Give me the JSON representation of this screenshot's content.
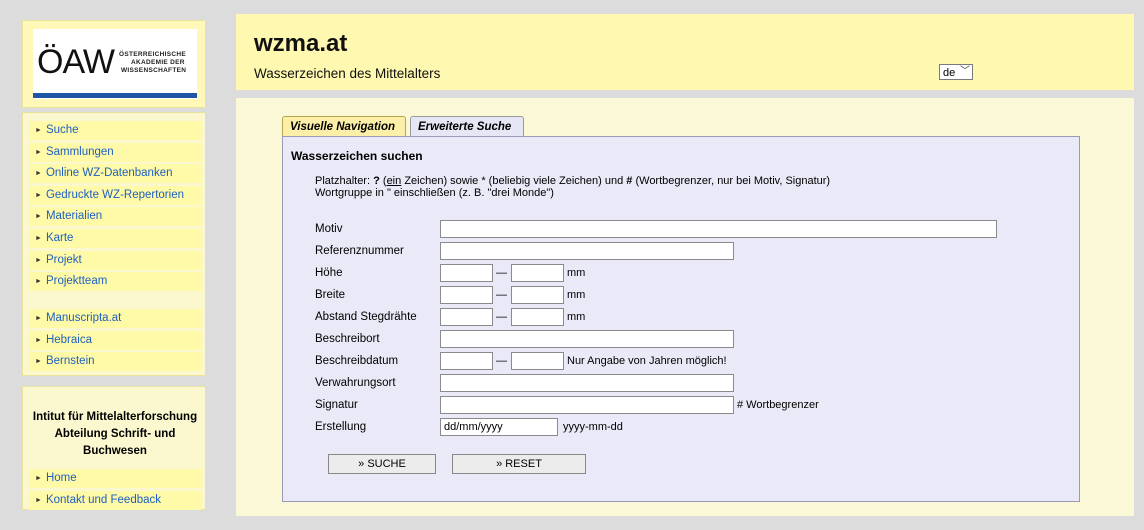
{
  "logo": {
    "big_text": "ÖAW",
    "small_line1": "ÖSTERREICHISCHE",
    "small_line2": "AKADEMIE DER",
    "small_line3": "WISSENSCHAFTEN",
    "bar_color": "#1f56a6"
  },
  "sidebar": {
    "items": [
      {
        "label": "Suche"
      },
      {
        "label": "Sammlungen"
      },
      {
        "label": "Online WZ-Datenbanken"
      },
      {
        "label": "Gedruckte WZ-Repertorien"
      },
      {
        "label": "Materialien"
      },
      {
        "label": "Karte"
      },
      {
        "label": "Projekt"
      },
      {
        "label": "Projektteam"
      }
    ],
    "items2": [
      {
        "label": "Manuscripta.at"
      },
      {
        "label": "Hebraica"
      },
      {
        "label": "Bernstein"
      }
    ],
    "arrow_glyph": "►"
  },
  "info": {
    "line1": "Intitut für Mittelalterforschung",
    "line2": "Abteilung Schrift- und",
    "line3": "Buchwesen",
    "links": [
      {
        "label": "Home"
      },
      {
        "label": "Kontakt und Feedback"
      }
    ]
  },
  "header": {
    "title": "wzma.at",
    "subtitle": "Wasserzeichen des Mittelalters",
    "language": "de"
  },
  "tabs": [
    {
      "label": "Visuelle Navigation"
    },
    {
      "label": "Erweiterte Suche"
    }
  ],
  "form": {
    "title": "Wasserzeichen suchen",
    "hint_placeholder_label": "Platzhalter:",
    "hint_q": "?",
    "hint_open": "(",
    "hint_ein": "ein",
    "hint_mid": "Zeichen) sowie * (beliebig viele Zeichen) und",
    "hint_hash": "#",
    "hint_end": "(Wortbegrenzer, nur bei Motiv, Signatur)",
    "hint_line2": "Wortgruppe in \" einschließen (z. B. \"drei Monde\")",
    "fields": {
      "motiv": "Motiv",
      "referenz": "Referenznummer",
      "hoehe": "Höhe",
      "breite": "Breite",
      "abstand": "Abstand Stegdrähte",
      "beschreibort": "Beschreibort",
      "beschreibdatum": "Beschreibdatum",
      "verwahrungsort": "Verwahrungsort",
      "signatur": "Signatur",
      "erstellung": "Erstellung"
    },
    "dash": "—",
    "unit_mm": "mm",
    "note_years": "Nur Angabe von Jahren möglich!",
    "note_wortbegrenzer": "# Wortbegrenzer",
    "erstellung_value": "dd/mm/yyyy",
    "erstellung_format": "yyyy-mm-dd",
    "search_button": "» SUCHE",
    "reset_button": "» RESET"
  }
}
